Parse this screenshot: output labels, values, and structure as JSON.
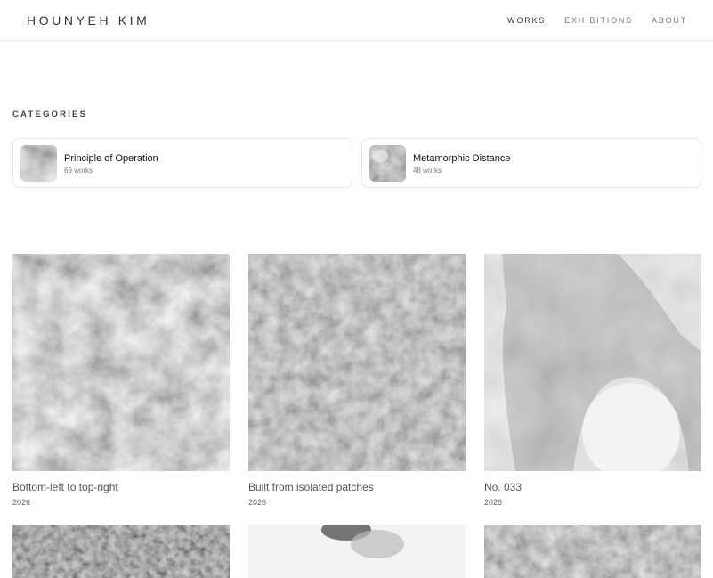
{
  "header": {
    "logo": "HOUNYEH KIM",
    "nav": [
      {
        "label": "WORKS",
        "active": true
      },
      {
        "label": "EXHIBITIONS",
        "active": false
      },
      {
        "label": "ABOUT",
        "active": false
      }
    ]
  },
  "categories": {
    "title": "CATEGORIES",
    "items": [
      {
        "name": "Principle of Operation",
        "count": "69 works"
      },
      {
        "name": "Metamorphic Distance",
        "count": "48 works"
      }
    ]
  },
  "works": [
    {
      "title": "Bottom-left to top-right",
      "year": "2026"
    },
    {
      "title": "Built from isolated patches",
      "year": "2026"
    },
    {
      "title": "No. 033",
      "year": "2026"
    }
  ],
  "colors": {
    "accent_underline": "#888888",
    "card_border": "#e7e7e7",
    "text_muted": "#777777"
  }
}
